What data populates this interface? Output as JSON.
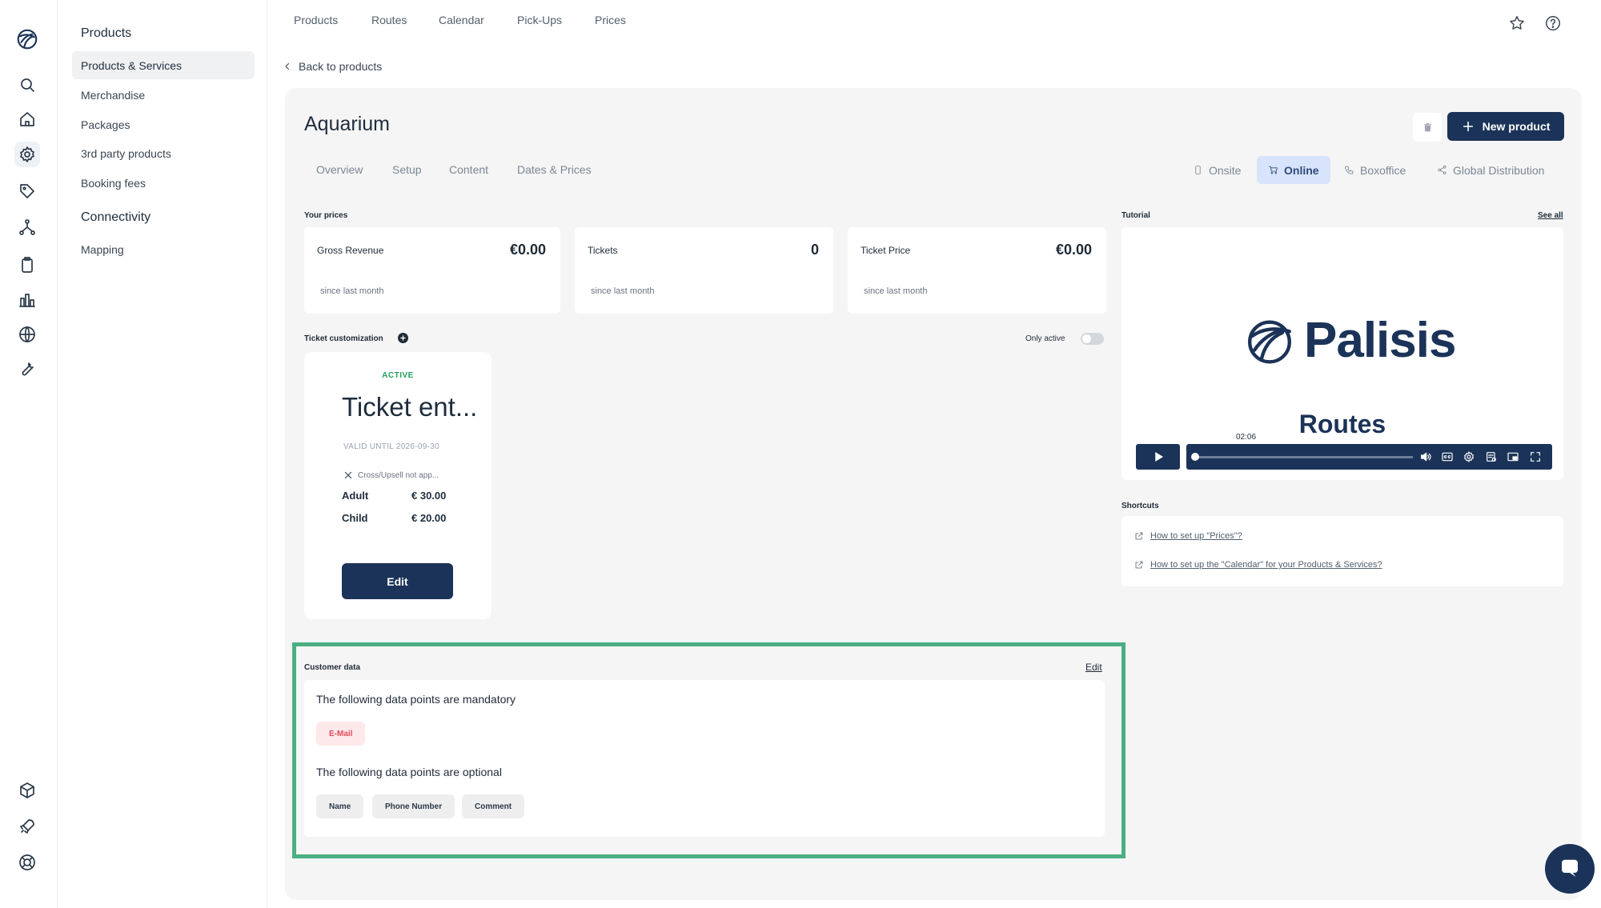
{
  "subnav": {
    "sections": [
      {
        "heading": "Products",
        "items": [
          "Products & Services",
          "Merchandise",
          "Packages",
          "3rd party products",
          "Booking fees"
        ]
      },
      {
        "heading": "Connectivity",
        "items": [
          "Mapping"
        ]
      }
    ]
  },
  "topnav": {
    "tabs": [
      "Products",
      "Routes",
      "Calendar",
      "Pick-Ups",
      "Prices"
    ]
  },
  "back_link": "Back to products",
  "product": {
    "title": "Aquarium",
    "new_button": "New product",
    "tabs": [
      "Overview",
      "Setup",
      "Content",
      "Dates & Prices"
    ],
    "channels": [
      "Onsite",
      "Online",
      "Boxoffice",
      "Global Distribution"
    ],
    "active_channel": "Online"
  },
  "prices": {
    "section_label": "Your prices",
    "cards": [
      {
        "label": "Gross Revenue",
        "value": "€0.00",
        "sub": "since last month"
      },
      {
        "label": "Tickets",
        "value": "0",
        "sub": "since last month"
      },
      {
        "label": "Ticket Price",
        "value": "€0.00",
        "sub": "since last month"
      }
    ]
  },
  "ticket_customization": {
    "label": "Ticket customization",
    "only_active_label": "Only active",
    "ticket": {
      "status": "ACTIVE",
      "name": "Ticket ent...",
      "valid": "VALID UNTIL 2026-09-30",
      "cross_upsell": "Cross/Upsell not app...",
      "prices": [
        {
          "type": "Adult",
          "price": "€ 30.00"
        },
        {
          "type": "Child",
          "price": "€ 20.00"
        }
      ],
      "edit_label": "Edit"
    }
  },
  "tutorial": {
    "label": "Tutorial",
    "see_all": "See all",
    "brand": "Palisis",
    "caption": "Routes",
    "time": "02:06"
  },
  "shortcuts": {
    "label": "Shortcuts",
    "links": [
      "How to set up \"Prices\"?",
      "How to set up the \"Calendar\" for your Products & Services?"
    ]
  },
  "customer_data": {
    "label": "Customer data",
    "edit_label": "Edit",
    "mandatory_text": "The following data points are mandatory",
    "mandatory": [
      "E-Mail"
    ],
    "optional_text": "The following data points are optional",
    "optional": [
      "Name",
      "Phone Number",
      "Comment"
    ]
  },
  "colors": {
    "primary": "#1b3358",
    "highlight_frame": "#4caf82",
    "active_green": "#22a05b",
    "required_red": "#e04a5a"
  }
}
